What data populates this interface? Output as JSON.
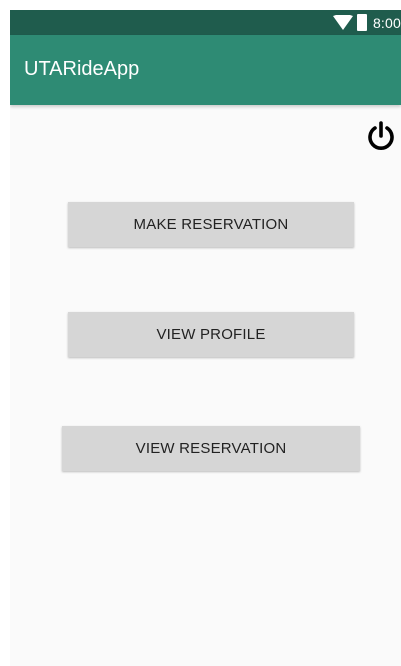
{
  "status_bar": {
    "time": "8:00",
    "icons": [
      "wifi-icon",
      "battery-icon"
    ]
  },
  "app_bar": {
    "title": "UTARideApp"
  },
  "toolbar": {
    "power_icon": "power-icon"
  },
  "buttons": {
    "make_reservation": "MAKE RESERVATION",
    "view_profile": "VIEW PROFILE",
    "view_reservation": "VIEW RESERVATION"
  },
  "colors": {
    "status_bar": "#1f5c4d",
    "app_bar": "#2e8b74",
    "background": "#fafafa",
    "button": "#d6d6d6"
  }
}
